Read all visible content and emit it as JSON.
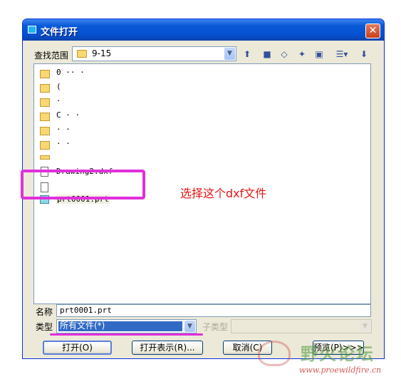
{
  "window": {
    "title": "文件打开",
    "close_glyph": "✕"
  },
  "lookin": {
    "label": "查找范围",
    "value": "9-15"
  },
  "files": [
    {
      "type": "folder",
      "name": "0 ·· ·"
    },
    {
      "type": "folder",
      "name": "("
    },
    {
      "type": "folder",
      "name": "·"
    },
    {
      "type": "folder",
      "name": "C · ·"
    },
    {
      "type": "folder",
      "name": "· ·"
    },
    {
      "type": "folder",
      "name": "· ·"
    },
    {
      "type": "folder",
      "name": ""
    },
    {
      "type": "file",
      "name": "Drawing2.dxf"
    },
    {
      "type": "file",
      "name": ""
    },
    {
      "type": "part",
      "name": "prt0001.prt"
    }
  ],
  "annotation": {
    "text": "选择这个dxf文件"
  },
  "name_field": {
    "label": "名称",
    "value": "prt0001.prt"
  },
  "type_field": {
    "label": "类型",
    "value": "所有文件(*)"
  },
  "subtype_field": {
    "label": "子类型",
    "value": ""
  },
  "buttons": {
    "open": "打开(O)",
    "open_show": "打开表示(R)...",
    "cancel": "取消(C)",
    "preview": "预览(P)>>>"
  },
  "watermark": {
    "logo_text": "野火论坛",
    "url": "www.proewildfire.cn"
  },
  "colors": {
    "highlight": "#e12fdc",
    "annotation": "#e61414",
    "title_bar": "#0551d1"
  }
}
